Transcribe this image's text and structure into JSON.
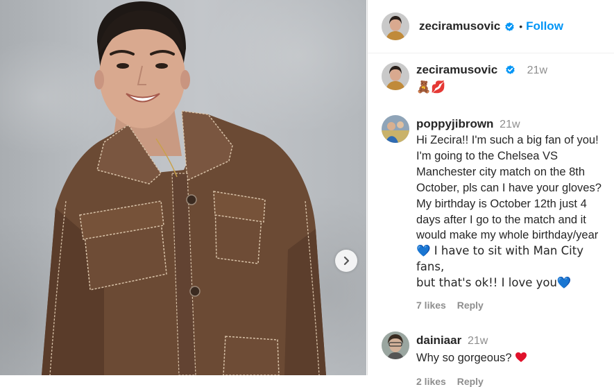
{
  "post": {
    "next_icon": "chevron-right-icon"
  },
  "header": {
    "username": "zeciramusovic",
    "separator": "•",
    "follow_label": "Follow",
    "verified_icon": "verified-badge-icon"
  },
  "comments": [
    {
      "username": "zeciramusovic",
      "time": "21w",
      "text": "🧸💋"
    },
    {
      "username": "poppyjibrown",
      "time": "21w",
      "lines": [
        "Hi Zecira!! I'm such a big fan of you!",
        "I'm going to the Chelsea VS",
        "Manchester city match on the 8th",
        "October, pls can I have your gloves?",
        "My birthday is October 12th just 4",
        "days after I go to the match and it",
        "would make my whole birthday/year",
        "💙 I have to sit with Man City fans,",
        "but that's ok!! I love you💙"
      ],
      "likes": "7 likes",
      "reply": "Reply"
    },
    {
      "username": "dainiaar",
      "time": "21w",
      "text": "Why so gorgeous?",
      "heart_icon": "red-heart-icon",
      "likes": "2 likes",
      "reply": "Reply"
    }
  ],
  "colors": {
    "accent": "#0095f6",
    "verified": "#0095f6",
    "muted": "#8e8e8e",
    "jacket": "#6b4a34"
  }
}
